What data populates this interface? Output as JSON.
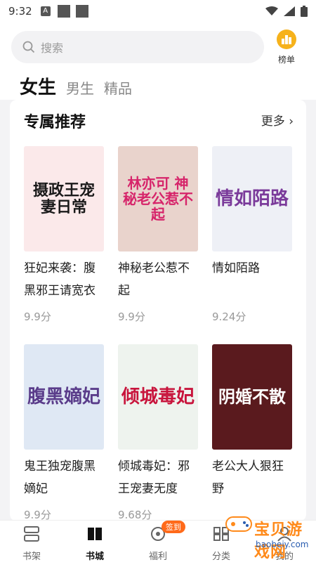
{
  "status": {
    "time": "9:32",
    "a_label": "A"
  },
  "search": {
    "placeholder": "搜索"
  },
  "rank": {
    "label": "榜单"
  },
  "tabs": [
    "女生",
    "男生",
    "精品"
  ],
  "section": {
    "title": "专属推荐",
    "more": "更多"
  },
  "books": [
    {
      "name": "狂妃来袭：腹黑邪王请宽衣",
      "score": "9.9分",
      "cover_title": "摄政王宠妻日常",
      "cover_bg": "#fbe9ea",
      "cover_fg": "#1a1a1a"
    },
    {
      "name": "神秘老公惹不起",
      "score": "9.9分",
      "cover_title": "林亦可 神秘老公惹不起",
      "cover_bg": "#e9d3cc",
      "cover_fg": "#d6246a"
    },
    {
      "name": "情如陌路",
      "score": "9.24分",
      "cover_title": "情如陌路",
      "cover_bg": "#eef0f6",
      "cover_fg": "#7a3a9a"
    },
    {
      "name": "鬼王独宠腹黑嫡妃",
      "score": "9.9分",
      "cover_title": "腹黑嫡妃",
      "cover_bg": "#dfe8f4",
      "cover_fg": "#5a3c8a"
    },
    {
      "name": "倾城毒妃：邪王宠妻无度",
      "score": "9.68分",
      "cover_title": "倾城毒妃",
      "cover_bg": "#eef3ee",
      "cover_fg": "#c8143c"
    },
    {
      "name": "老公大人狠狂野",
      "score": "",
      "cover_title": "阴婚不散",
      "cover_bg": "#5a1a1e",
      "cover_fg": "#ffffff"
    }
  ],
  "tabbar": [
    {
      "label": "书架",
      "icon": "bookshelf-icon"
    },
    {
      "label": "书城",
      "icon": "book-icon"
    },
    {
      "label": "福利",
      "icon": "gift-icon",
      "badge": "签到"
    },
    {
      "label": "分类",
      "icon": "category-icon"
    },
    {
      "label": "我的",
      "icon": "user-icon"
    }
  ],
  "watermark": {
    "text": "宝贝游戏网",
    "url": "baobeiy.com"
  },
  "colors": {
    "accent": "#f6b21b",
    "badge": "#ff6a1a"
  }
}
